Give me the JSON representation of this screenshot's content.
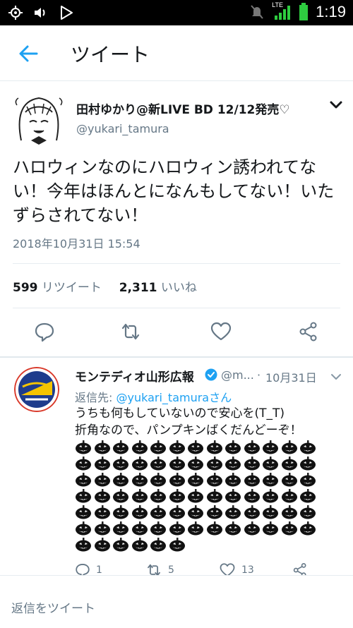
{
  "statusbar": {
    "time": "1:19",
    "network": "LTE"
  },
  "header": {
    "title": "ツイート"
  },
  "tweet": {
    "author_name": "田村ゆかり@新LIVE BD 12/12発売♡",
    "author_handle": "@yukari_tamura",
    "text": "ハロウィンなのにハロウィン誘われてない！今年はほんとになんもしてない！いたずらされてない！",
    "timestamp": "2018年10月31日 15:54",
    "retweets_count": "599",
    "retweets_label": "リツイート",
    "likes_count": "2,311",
    "likes_label": "いいね"
  },
  "reply": {
    "author_name": "モンテディオ山形広報",
    "author_handle": "@m...",
    "separator": "·",
    "date": "10月31日",
    "reply_to_label": "返信先:",
    "reply_to_handle": "@yukari_tamuraさん",
    "line1": "うちも何もしていないので安心を(T_T)",
    "line2": "折角なので、パンプキンばくだんどーぞ！",
    "pumpkin_count": 84,
    "reply_count": "1",
    "retweet_count": "5",
    "like_count": "13"
  },
  "compose": {
    "placeholder": "返信をツイート"
  },
  "colors": {
    "accent": "#1da1f2",
    "muted": "#657786",
    "text": "#14171a"
  }
}
